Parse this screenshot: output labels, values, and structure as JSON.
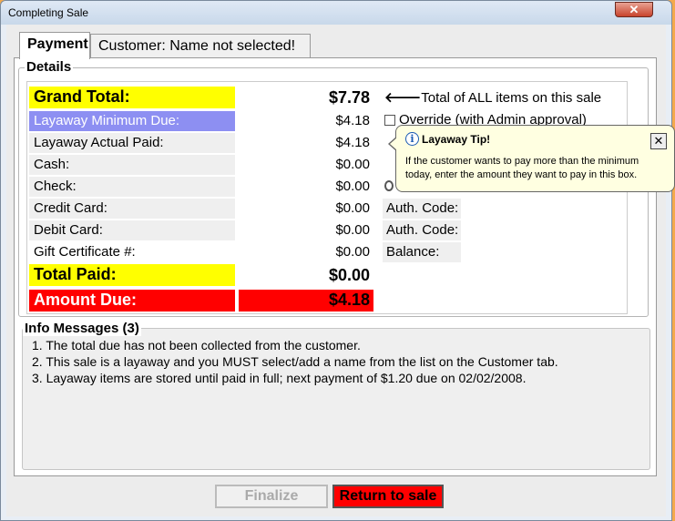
{
  "window": {
    "title": "Completing Sale",
    "close_glyph": "✕"
  },
  "tabs": [
    {
      "label": "Payment"
    },
    {
      "label": "Customer: Name not selected!"
    }
  ],
  "details": {
    "group_label": "Details",
    "grand_total": {
      "label": "Grand Total:",
      "value": "$7.78",
      "note": "Total of ALL items on this sale"
    },
    "layaway_min": {
      "label": "Layaway Minimum Due:",
      "value": "$4.18",
      "override_label": "Override (with Admin approval)"
    },
    "layaway_paid": {
      "label": "Layaway Actual Paid:",
      "value": "$4.18"
    },
    "cash": {
      "label": "Cash:",
      "value": "$0.00"
    },
    "check": {
      "label": "Check:",
      "value": "$0.00"
    },
    "credit": {
      "label": "Credit Card:",
      "value": "$0.00",
      "auth": "Auth. Code:"
    },
    "debit": {
      "label": "Debit Card:",
      "value": "$0.00",
      "auth": "Auth. Code:"
    },
    "gift": {
      "label": "Gift Certificate #:",
      "value": "$0.00",
      "balance": "Balance:"
    },
    "total_paid": {
      "label": "Total Paid:",
      "value": "$0.00"
    },
    "amount_due": {
      "label": "Amount Due:",
      "value": "$4.18"
    }
  },
  "tooltip": {
    "title": "Layaway Tip!",
    "body": "If the customer wants to pay more than the minimum today, enter the amount they want to pay in this box.",
    "close_glyph": "✕",
    "icon_glyph": "i"
  },
  "info": {
    "label": "Info Messages (3)",
    "messages": [
      "1.  The total due has not been collected from the customer.",
      "2.  This sale is a layaway and you MUST select/add a name from the list on the Customer tab.",
      "3.  Layaway items are stored until paid in full; next payment of $1.20 due on 02/02/2008."
    ]
  },
  "buttons": {
    "finalize": "Finalize",
    "return": "Return to sale"
  },
  "colors": {
    "grand_total": "#ffff00",
    "layaway_min": "#8d8ff2",
    "amount_due": "#ff0000"
  }
}
